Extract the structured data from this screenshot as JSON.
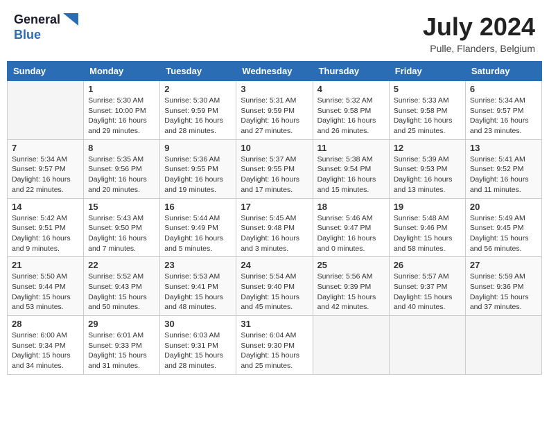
{
  "header": {
    "logo_line1": "General",
    "logo_line2": "Blue",
    "month_title": "July 2024",
    "location": "Pulle, Flanders, Belgium"
  },
  "columns": [
    "Sunday",
    "Monday",
    "Tuesday",
    "Wednesday",
    "Thursday",
    "Friday",
    "Saturday"
  ],
  "weeks": [
    [
      {
        "day": "",
        "info": ""
      },
      {
        "day": "1",
        "info": "Sunrise: 5:30 AM\nSunset: 10:00 PM\nDaylight: 16 hours\nand 29 minutes."
      },
      {
        "day": "2",
        "info": "Sunrise: 5:30 AM\nSunset: 9:59 PM\nDaylight: 16 hours\nand 28 minutes."
      },
      {
        "day": "3",
        "info": "Sunrise: 5:31 AM\nSunset: 9:59 PM\nDaylight: 16 hours\nand 27 minutes."
      },
      {
        "day": "4",
        "info": "Sunrise: 5:32 AM\nSunset: 9:58 PM\nDaylight: 16 hours\nand 26 minutes."
      },
      {
        "day": "5",
        "info": "Sunrise: 5:33 AM\nSunset: 9:58 PM\nDaylight: 16 hours\nand 25 minutes."
      },
      {
        "day": "6",
        "info": "Sunrise: 5:34 AM\nSunset: 9:57 PM\nDaylight: 16 hours\nand 23 minutes."
      }
    ],
    [
      {
        "day": "7",
        "info": "Sunrise: 5:34 AM\nSunset: 9:57 PM\nDaylight: 16 hours\nand 22 minutes."
      },
      {
        "day": "8",
        "info": "Sunrise: 5:35 AM\nSunset: 9:56 PM\nDaylight: 16 hours\nand 20 minutes."
      },
      {
        "day": "9",
        "info": "Sunrise: 5:36 AM\nSunset: 9:55 PM\nDaylight: 16 hours\nand 19 minutes."
      },
      {
        "day": "10",
        "info": "Sunrise: 5:37 AM\nSunset: 9:55 PM\nDaylight: 16 hours\nand 17 minutes."
      },
      {
        "day": "11",
        "info": "Sunrise: 5:38 AM\nSunset: 9:54 PM\nDaylight: 16 hours\nand 15 minutes."
      },
      {
        "day": "12",
        "info": "Sunrise: 5:39 AM\nSunset: 9:53 PM\nDaylight: 16 hours\nand 13 minutes."
      },
      {
        "day": "13",
        "info": "Sunrise: 5:41 AM\nSunset: 9:52 PM\nDaylight: 16 hours\nand 11 minutes."
      }
    ],
    [
      {
        "day": "14",
        "info": "Sunrise: 5:42 AM\nSunset: 9:51 PM\nDaylight: 16 hours\nand 9 minutes."
      },
      {
        "day": "15",
        "info": "Sunrise: 5:43 AM\nSunset: 9:50 PM\nDaylight: 16 hours\nand 7 minutes."
      },
      {
        "day": "16",
        "info": "Sunrise: 5:44 AM\nSunset: 9:49 PM\nDaylight: 16 hours\nand 5 minutes."
      },
      {
        "day": "17",
        "info": "Sunrise: 5:45 AM\nSunset: 9:48 PM\nDaylight: 16 hours\nand 3 minutes."
      },
      {
        "day": "18",
        "info": "Sunrise: 5:46 AM\nSunset: 9:47 PM\nDaylight: 16 hours\nand 0 minutes."
      },
      {
        "day": "19",
        "info": "Sunrise: 5:48 AM\nSunset: 9:46 PM\nDaylight: 15 hours\nand 58 minutes."
      },
      {
        "day": "20",
        "info": "Sunrise: 5:49 AM\nSunset: 9:45 PM\nDaylight: 15 hours\nand 56 minutes."
      }
    ],
    [
      {
        "day": "21",
        "info": "Sunrise: 5:50 AM\nSunset: 9:44 PM\nDaylight: 15 hours\nand 53 minutes."
      },
      {
        "day": "22",
        "info": "Sunrise: 5:52 AM\nSunset: 9:43 PM\nDaylight: 15 hours\nand 50 minutes."
      },
      {
        "day": "23",
        "info": "Sunrise: 5:53 AM\nSunset: 9:41 PM\nDaylight: 15 hours\nand 48 minutes."
      },
      {
        "day": "24",
        "info": "Sunrise: 5:54 AM\nSunset: 9:40 PM\nDaylight: 15 hours\nand 45 minutes."
      },
      {
        "day": "25",
        "info": "Sunrise: 5:56 AM\nSunset: 9:39 PM\nDaylight: 15 hours\nand 42 minutes."
      },
      {
        "day": "26",
        "info": "Sunrise: 5:57 AM\nSunset: 9:37 PM\nDaylight: 15 hours\nand 40 minutes."
      },
      {
        "day": "27",
        "info": "Sunrise: 5:59 AM\nSunset: 9:36 PM\nDaylight: 15 hours\nand 37 minutes."
      }
    ],
    [
      {
        "day": "28",
        "info": "Sunrise: 6:00 AM\nSunset: 9:34 PM\nDaylight: 15 hours\nand 34 minutes."
      },
      {
        "day": "29",
        "info": "Sunrise: 6:01 AM\nSunset: 9:33 PM\nDaylight: 15 hours\nand 31 minutes."
      },
      {
        "day": "30",
        "info": "Sunrise: 6:03 AM\nSunset: 9:31 PM\nDaylight: 15 hours\nand 28 minutes."
      },
      {
        "day": "31",
        "info": "Sunrise: 6:04 AM\nSunset: 9:30 PM\nDaylight: 15 hours\nand 25 minutes."
      },
      {
        "day": "",
        "info": ""
      },
      {
        "day": "",
        "info": ""
      },
      {
        "day": "",
        "info": ""
      }
    ]
  ]
}
